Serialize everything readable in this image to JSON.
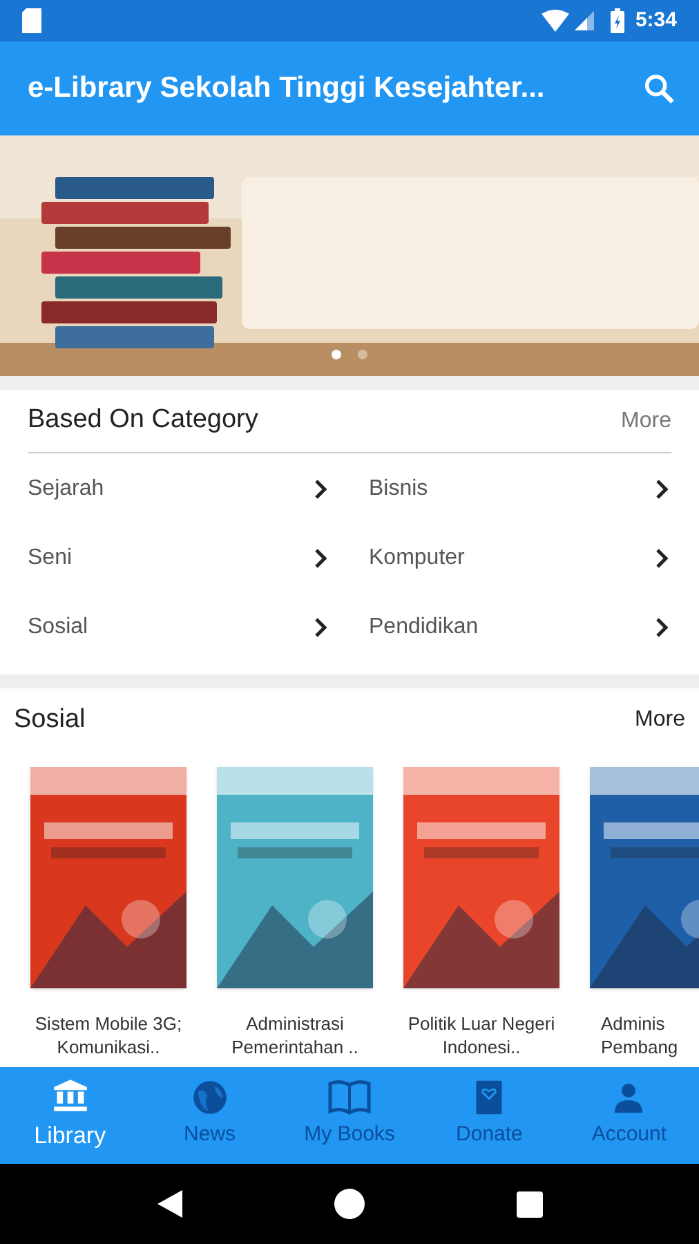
{
  "status_bar": {
    "time": "5:34"
  },
  "app_bar": {
    "title": "e-Library Sekolah Tinggi Kesejahter..."
  },
  "banner": {
    "dots": [
      {
        "selected": true
      },
      {
        "selected": false
      }
    ]
  },
  "category_section": {
    "title": "Based On Category",
    "more": "More",
    "items": [
      {
        "label": "Sejarah"
      },
      {
        "label": "Bisnis"
      },
      {
        "label": "Seni"
      },
      {
        "label": "Komputer"
      },
      {
        "label": "Sosial"
      },
      {
        "label": "Pendidikan"
      }
    ]
  },
  "book_section": {
    "title": "Sosial",
    "more": "More",
    "books": [
      {
        "title": "Sistem Mobile 3G; Komunikasi.."
      },
      {
        "title": "Administrasi Pemerintahan .."
      },
      {
        "title": "Politik Luar Negeri Indonesi.."
      },
      {
        "title": "Adminis Pembang"
      }
    ]
  },
  "bottom_nav": [
    {
      "label": "Library",
      "selected": true
    },
    {
      "label": "News",
      "selected": false
    },
    {
      "label": "My Books",
      "selected": false
    },
    {
      "label": "Donate",
      "selected": false
    },
    {
      "label": "Account",
      "selected": false
    }
  ]
}
